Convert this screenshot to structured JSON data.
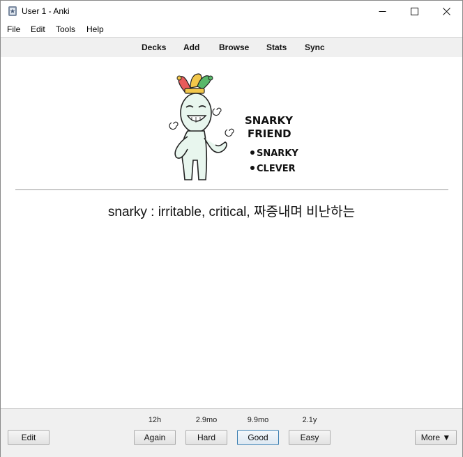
{
  "window": {
    "title": "User 1 - Anki"
  },
  "menubar": {
    "items": [
      {
        "label": "File"
      },
      {
        "label": "Edit"
      },
      {
        "label": "Tools"
      },
      {
        "label": "Help"
      }
    ]
  },
  "toolbar": {
    "items": [
      {
        "label": "Decks"
      },
      {
        "label": "Add"
      },
      {
        "label": "Browse"
      },
      {
        "label": "Stats"
      },
      {
        "label": "Sync"
      }
    ]
  },
  "card": {
    "image": {
      "title_line1": "SNARKY",
      "title_line2": "FRIEND",
      "bullet1": "SNARKY",
      "bullet2": "CLEVER"
    },
    "answer": "snarky : irritable, critical, 짜증내며 비난하는"
  },
  "bottom": {
    "edit_label": "Edit",
    "more_label": "More ▼",
    "answer_buttons": [
      {
        "label": "Again",
        "interval": "12h"
      },
      {
        "label": "Hard",
        "interval": "2.9mo"
      },
      {
        "label": "Good",
        "interval": "9.9mo"
      },
      {
        "label": "Easy",
        "interval": "2.1y"
      }
    ]
  }
}
